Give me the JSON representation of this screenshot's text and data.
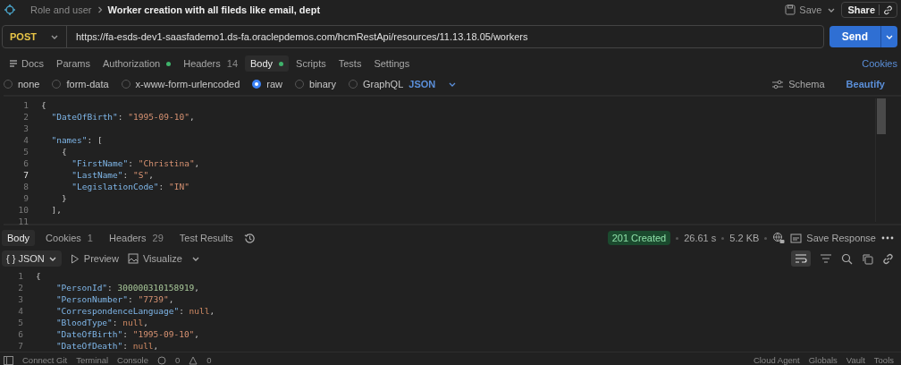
{
  "header": {
    "breadcrumb": "Role and user",
    "title": "Worker creation with all fileds like email, dept",
    "save": "Save",
    "share": "Share"
  },
  "request": {
    "method": "POST",
    "url": "https://fa-esds-dev1-saasfademo1.ds-fa.oraclepdemos.com/hcmRestApi/resources/11.13.18.05/workers",
    "send": "Send"
  },
  "request_tabs": [
    {
      "kind": "docs",
      "label": "Docs",
      "dot": false,
      "selected": false
    },
    {
      "kind": "tab",
      "label": "Params",
      "dot": false,
      "selected": false
    },
    {
      "kind": "tab",
      "label": "Authorization",
      "dot": true,
      "selected": false
    },
    {
      "kind": "tab",
      "label": "Headers",
      "count": "14",
      "dot": false,
      "selected": false
    },
    {
      "kind": "tab",
      "label": "Body",
      "dot": true,
      "selected": true
    },
    {
      "kind": "tab",
      "label": "Scripts",
      "dot": false,
      "selected": false
    },
    {
      "kind": "tab",
      "label": "Tests",
      "dot": false,
      "selected": false
    },
    {
      "kind": "tab",
      "label": "Settings",
      "dot": false,
      "selected": false
    }
  ],
  "cookies": "Cookies",
  "body_types": [
    {
      "label": "none",
      "selected": false
    },
    {
      "label": "form-data",
      "selected": false
    },
    {
      "label": "x-www-form-urlencoded",
      "selected": false
    },
    {
      "label": "raw",
      "selected": true
    },
    {
      "label": "binary",
      "selected": false
    },
    {
      "label": "GraphQL",
      "selected": false
    }
  ],
  "body_format": "JSON",
  "schema": "Schema",
  "beautify": "Beautify",
  "request_body": [
    {
      "num": "1",
      "active": false,
      "tokens": [
        {
          "kind": "punct",
          "text": "{"
        }
      ]
    },
    {
      "num": "2",
      "active": false,
      "tokens": [
        {
          "kind": "key",
          "text": "  \"DateOfBirth\""
        },
        {
          "kind": "punct",
          "text": ": "
        },
        {
          "kind": "str",
          "text": "\"1995-09-10\""
        },
        {
          "kind": "punct",
          "text": ","
        }
      ]
    },
    {
      "num": "3",
      "active": false
    },
    {
      "num": "4",
      "active": false,
      "tokens": [
        {
          "kind": "key",
          "text": "  \"names\""
        },
        {
          "kind": "punct",
          "text": ": ["
        }
      ]
    },
    {
      "num": "5",
      "active": false,
      "tokens": [
        {
          "kind": "punct",
          "text": "    {"
        }
      ]
    },
    {
      "num": "6",
      "active": false,
      "tokens": [
        {
          "kind": "key",
          "text": "      \"FirstName\""
        },
        {
          "kind": "punct",
          "text": ": "
        },
        {
          "kind": "str",
          "text": "\"Christina\""
        },
        {
          "kind": "punct",
          "text": ","
        }
      ]
    },
    {
      "num": "7",
      "active": true,
      "tokens": [
        {
          "kind": "key",
          "text": "      \"LastName\""
        },
        {
          "kind": "punct",
          "text": ": "
        },
        {
          "kind": "str",
          "text": "\"S\""
        },
        {
          "kind": "punct",
          "text": ","
        }
      ]
    },
    {
      "num": "8",
      "active": false,
      "tokens": [
        {
          "kind": "key",
          "text": "      \"LegislationCode\""
        },
        {
          "kind": "punct",
          "text": ": "
        },
        {
          "kind": "str",
          "text": "\"IN\""
        }
      ]
    },
    {
      "num": "9",
      "active": false,
      "tokens": [
        {
          "kind": "punct",
          "text": "    }"
        }
      ]
    },
    {
      "num": "10",
      "active": false,
      "tokens": [
        {
          "kind": "punct",
          "text": "  ],"
        }
      ]
    },
    {
      "num": "11",
      "active": false
    }
  ],
  "response_tabs": [
    {
      "label": "Body",
      "selected": true
    },
    {
      "label": "Cookies",
      "count": "1",
      "selected": false
    },
    {
      "label": "Headers",
      "count": "29",
      "selected": false
    },
    {
      "label": "Test Results",
      "selected": false
    }
  ],
  "response_status": {
    "code": "201 Created",
    "time": "26.61 s",
    "size": "5.2 KB",
    "save_response": "Save Response"
  },
  "response_view": {
    "format_icon": "{ }",
    "format": "JSON",
    "preview": "Preview",
    "visualize": "Visualize",
    "word_wrap": true
  },
  "response_body": [
    {
      "num": "1",
      "tokens": [
        {
          "kind": "punct",
          "text": "{"
        }
      ]
    },
    {
      "num": "2",
      "tokens": [
        {
          "kind": "key",
          "text": "    \"PersonId\""
        },
        {
          "kind": "punct",
          "text": ": "
        },
        {
          "kind": "num",
          "text": "300000310158919"
        },
        {
          "kind": "punct",
          "text": ","
        }
      ]
    },
    {
      "num": "3",
      "tokens": [
        {
          "kind": "key",
          "text": "    \"PersonNumber\""
        },
        {
          "kind": "punct",
          "text": ": "
        },
        {
          "kind": "str",
          "text": "\"7739\""
        },
        {
          "kind": "punct",
          "text": ","
        }
      ]
    },
    {
      "num": "4",
      "tokens": [
        {
          "kind": "key",
          "text": "    \"CorrespondenceLanguage\""
        },
        {
          "kind": "punct",
          "text": ": "
        },
        {
          "kind": "null",
          "text": "null"
        },
        {
          "kind": "punct",
          "text": ","
        }
      ]
    },
    {
      "num": "5",
      "tokens": [
        {
          "kind": "key",
          "text": "    \"BloodType\""
        },
        {
          "kind": "punct",
          "text": ": "
        },
        {
          "kind": "null",
          "text": "null"
        },
        {
          "kind": "punct",
          "text": ","
        }
      ]
    },
    {
      "num": "6",
      "tokens": [
        {
          "kind": "key",
          "text": "    \"DateOfBirth\""
        },
        {
          "kind": "punct",
          "text": ": "
        },
        {
          "kind": "str",
          "text": "\"1995-09-10\""
        },
        {
          "kind": "punct",
          "text": ","
        }
      ]
    },
    {
      "num": "7",
      "tokens": [
        {
          "kind": "key",
          "text": "    \"DateOfDeath\""
        },
        {
          "kind": "punct",
          "text": ": "
        },
        {
          "kind": "null",
          "text": "null"
        },
        {
          "kind": "punct",
          "text": ","
        }
      ]
    }
  ],
  "status_bar": {
    "left": [
      "Connect Git",
      "Terminal",
      "Console"
    ],
    "errors": "0",
    "warnings": "0",
    "right": [
      "Cloud Agent",
      "Globals",
      "Vault",
      "Tools"
    ]
  }
}
